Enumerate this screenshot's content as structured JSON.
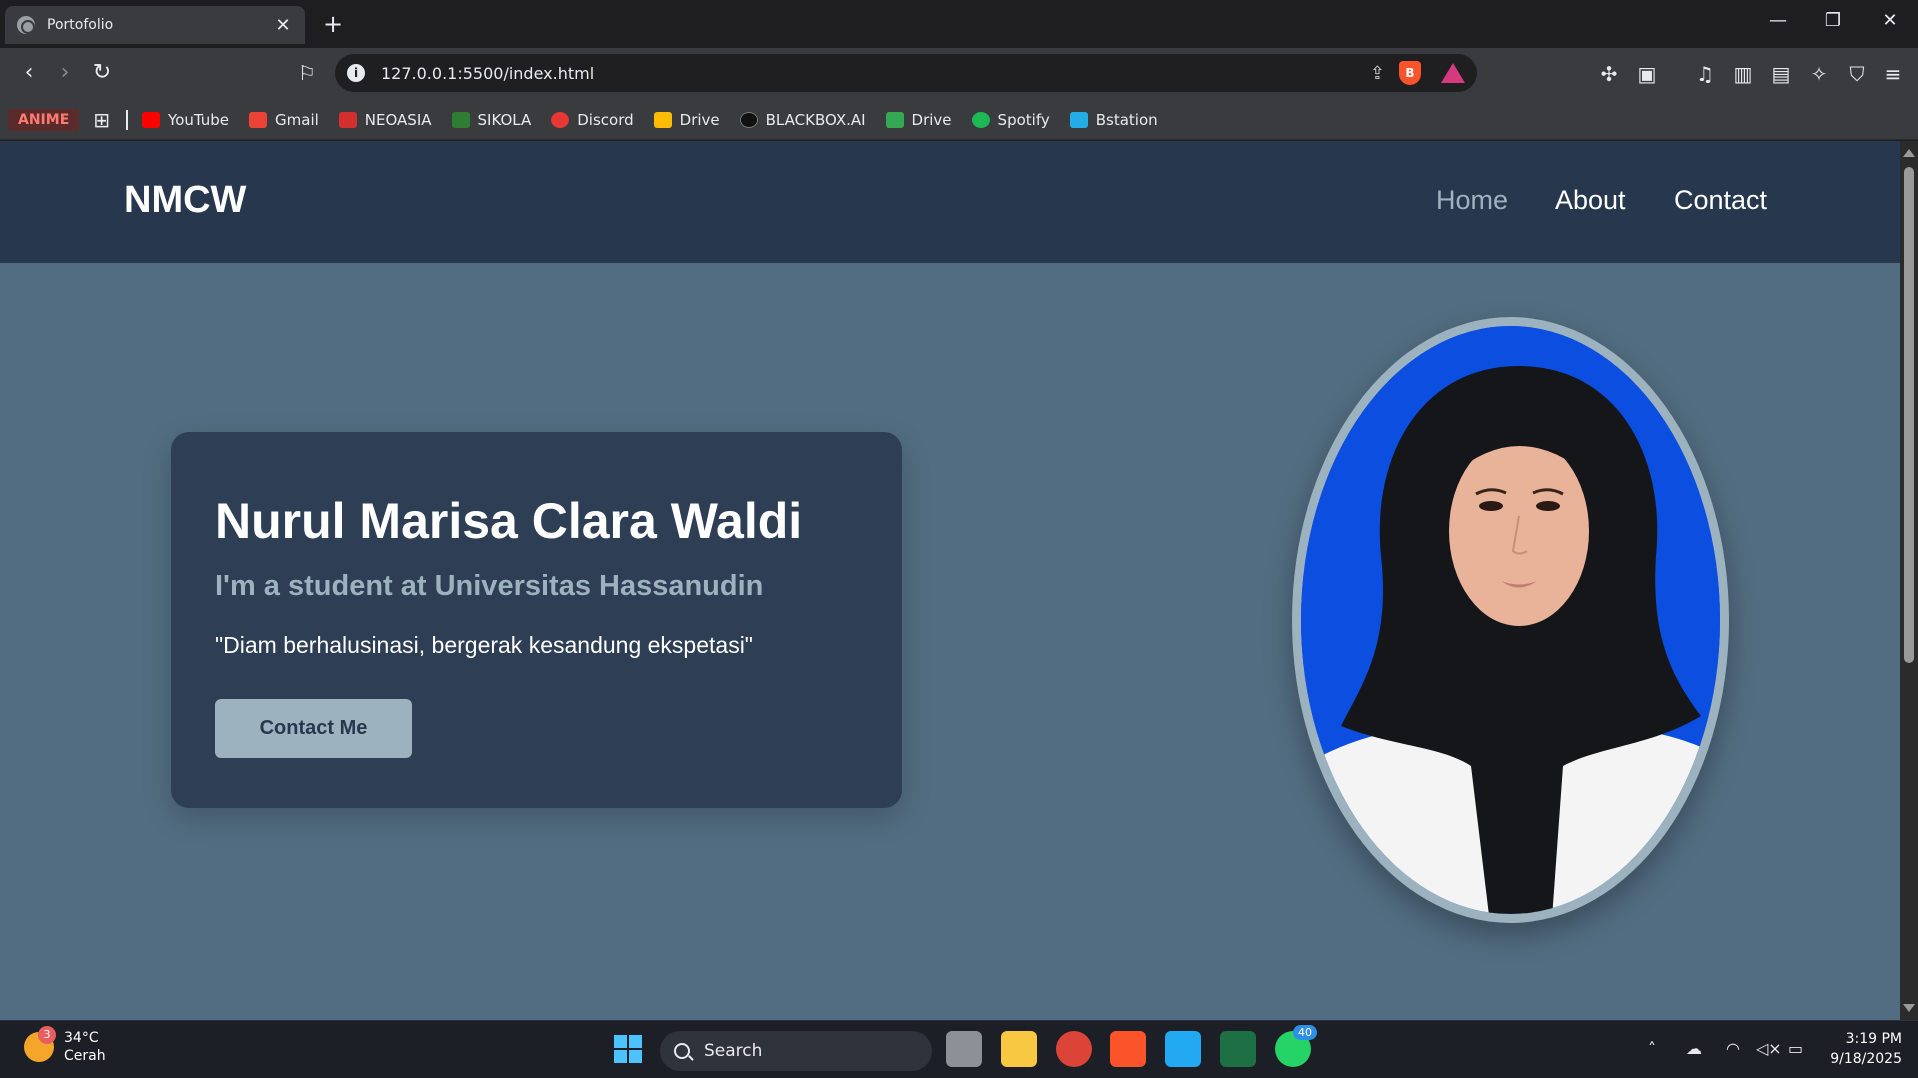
{
  "browser": {
    "tab_title": "Portofolio",
    "url": "127.0.0.1:5500/index.html",
    "new_tab": "+",
    "bookmarks": {
      "anime": "ANIME",
      "items": [
        {
          "label": "YouTube",
          "color": "#ff0000"
        },
        {
          "label": "Gmail",
          "color": "#ea4335"
        },
        {
          "label": "NEOASIA",
          "color": "#d32f2f"
        },
        {
          "label": "SIKOLA",
          "color": "#2e7d32"
        },
        {
          "label": "Discord",
          "color": "#e53935"
        },
        {
          "label": "Drive",
          "color": "#fbbc04"
        },
        {
          "label": "BLACKBOX.AI",
          "color": "#111111"
        },
        {
          "label": "Drive",
          "color": "#34a853"
        },
        {
          "label": "Spotify",
          "color": "#1db954"
        },
        {
          "label": "Bstation",
          "color": "#23ade5"
        }
      ]
    }
  },
  "site": {
    "logo": "NMCW",
    "nav": {
      "home": "Home",
      "about": "About",
      "contact": "Contact"
    },
    "hero": {
      "name": "Nurul Marisa Clara Waldi",
      "subtitle": "I'm a student at Universitas Hassanudin",
      "quote": "\"Diam berhalusinasi, bergerak kesandung ekspetasi\"",
      "cta": "Contact Me"
    },
    "colors": {
      "header": "#27374d",
      "page": "#526d82",
      "card": "#2d3e55",
      "accent": "#9db2bf"
    }
  },
  "taskbar": {
    "weather_temp": "34°C",
    "weather_desc": "Cerah",
    "weather_badge": "3",
    "search_placeholder": "Search",
    "whatsapp_badge": "40",
    "time": "3:19 PM",
    "date": "9/18/2025"
  }
}
